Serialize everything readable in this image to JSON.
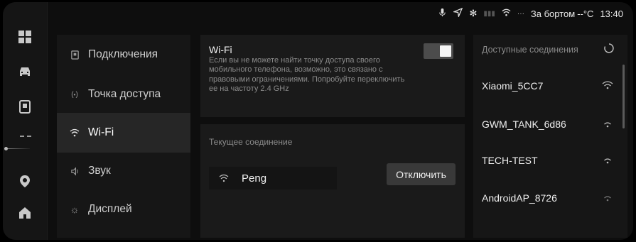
{
  "status_bar": {
    "outside_label": "За бортом",
    "temperature": "--°C",
    "time": "13:40",
    "icons": [
      "mic-icon",
      "location-arrow-icon",
      "bluetooth-icon",
      "signal-icon",
      "wifi-status-icon",
      "more-icon"
    ]
  },
  "rail": {
    "items": [
      "grid-apps-icon",
      "car-icon",
      "phone-icon",
      "navigation-pin-icon",
      "home-icon"
    ]
  },
  "menu": {
    "items": [
      {
        "label": "Подключения",
        "icon": "connections-icon",
        "active": false
      },
      {
        "label": "Точка доступа",
        "icon": "hotspot-icon",
        "active": false
      },
      {
        "label": "Wi-Fi",
        "icon": "wifi-icon",
        "active": true
      },
      {
        "label": "Звук",
        "icon": "sound-icon",
        "active": false
      },
      {
        "label": "Дисплей",
        "icon": "display-icon",
        "active": false
      }
    ]
  },
  "wifi": {
    "title": "Wi-Fi",
    "description": "Если вы не можете найти точку доступа своего мобильного телефона, возможно, это связано с правовыми ограничениями. Попробуйте переключить ее на частоту 2.4 GHz",
    "enabled": true
  },
  "current": {
    "title": "Текущее соединение",
    "network": "Peng",
    "disconnect_label": "Отключить"
  },
  "available": {
    "title": "Доступные соединения",
    "networks": [
      "Xiaomi_5CC7",
      "GWM_TANK_6d86",
      "TECH-TEST",
      "AndroidAP_8726"
    ]
  },
  "colors": {
    "background": "#0e0e0e",
    "panel": "#1a1a1a",
    "active_item": "#262626",
    "button": "#393939"
  }
}
